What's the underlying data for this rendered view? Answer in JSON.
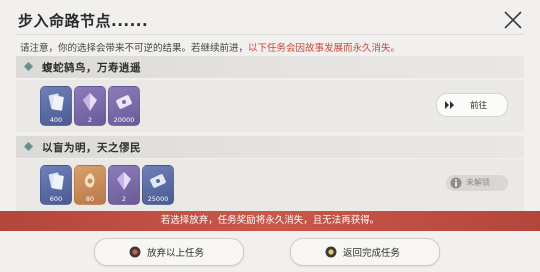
{
  "dialog": {
    "title": "步入命路节点......",
    "notice": "请注意，你的选择会带来不可逆的结果。若继续前进，",
    "notice_warning": "以下任务会因故事发展而永久消失。"
  },
  "tasks": [
    {
      "name": "蝮蛇鸫鸟，万寿逍遥",
      "rewards": [
        {
          "icon": "blue-card-reward-icon",
          "quantity": "400"
        },
        {
          "icon": "purple-crystal-reward-icon",
          "quantity": "2"
        },
        {
          "icon": "purple-pass-reward-icon",
          "quantity": "20000"
        }
      ],
      "action_label": "前往"
    },
    {
      "name": "以盲为明，天之僇民",
      "rewards": [
        {
          "icon": "blue-card-reward-icon",
          "quantity": "600"
        },
        {
          "icon": "orange-item-reward-icon",
          "quantity": "80"
        },
        {
          "icon": "purple-crystal-reward-icon",
          "quantity": "2"
        },
        {
          "icon": "purple-pass-reward-icon",
          "quantity": "25000"
        }
      ],
      "status_label": "未解锁"
    }
  ],
  "warning_bar": "若选择放弃，任务奖励将永久消失，且无法再获得。",
  "buttons": {
    "abandon": "放弃以上任务",
    "return": "返回完成任务"
  },
  "colors": {
    "warning_text": "#c8473a",
    "warning_bar": "#c0524a",
    "background": "#f1f0ee"
  }
}
